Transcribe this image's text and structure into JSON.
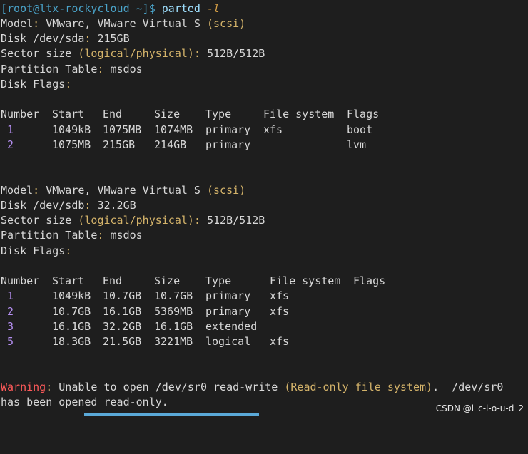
{
  "prompt": {
    "user_host": "[root@ltx-rockycloud ~]$",
    "command": "parted",
    "flag": "-l"
  },
  "disk1": {
    "model_label": "Model",
    "model_value": "VMware, VMware Virtual S",
    "model_paren": "(scsi)",
    "disk_label": "Disk /dev/sda",
    "disk_value": "215GB",
    "sector_label": "Sector size",
    "sector_paren": "(logical/physical)",
    "sector_value": "512B/512B",
    "pt_label": "Partition Table",
    "pt_value": "msdos",
    "flags_label": "Disk Flags",
    "headers": [
      "Number",
      "Start",
      "End",
      "Size",
      "Type",
      "File system",
      "Flags"
    ],
    "rows": [
      [
        "1",
        "1049kB",
        "1075MB",
        "1074MB",
        "primary",
        "xfs",
        "boot"
      ],
      [
        "2",
        "1075MB",
        "215GB",
        "214GB",
        "primary",
        "",
        "lvm"
      ]
    ]
  },
  "disk2": {
    "model_label": "Model",
    "model_value": "VMware, VMware Virtual S",
    "model_paren": "(scsi)",
    "disk_label": "Disk /dev/sdb",
    "disk_value": "32.2GB",
    "sector_label": "Sector size",
    "sector_paren": "(logical/physical)",
    "sector_value": "512B/512B",
    "pt_label": "Partition Table",
    "pt_value": "msdos",
    "flags_label": "Disk Flags",
    "headers": [
      "Number",
      "Start",
      "End",
      "Size",
      "Type",
      "File system",
      "Flags"
    ],
    "rows": [
      [
        "1",
        "1049kB",
        "10.7GB",
        "10.7GB",
        "primary",
        "xfs",
        ""
      ],
      [
        "2",
        "10.7GB",
        "16.1GB",
        "5369MB",
        "primary",
        "xfs",
        ""
      ],
      [
        "3",
        "16.1GB",
        "32.2GB",
        "16.1GB",
        "extended",
        "",
        ""
      ],
      [
        "5",
        "18.3GB",
        "21.5GB",
        "3221MB",
        "logical",
        "xfs",
        ""
      ]
    ]
  },
  "warning": {
    "label": "Warning",
    "text1": " Unable to open /dev/sr0 read-write ",
    "paren": "(Read-only file system)",
    "text2": ".  /dev/sr0",
    "line2": "has been opened read-only."
  },
  "watermark": "CSDN @l_c-l-o-u-d_2"
}
